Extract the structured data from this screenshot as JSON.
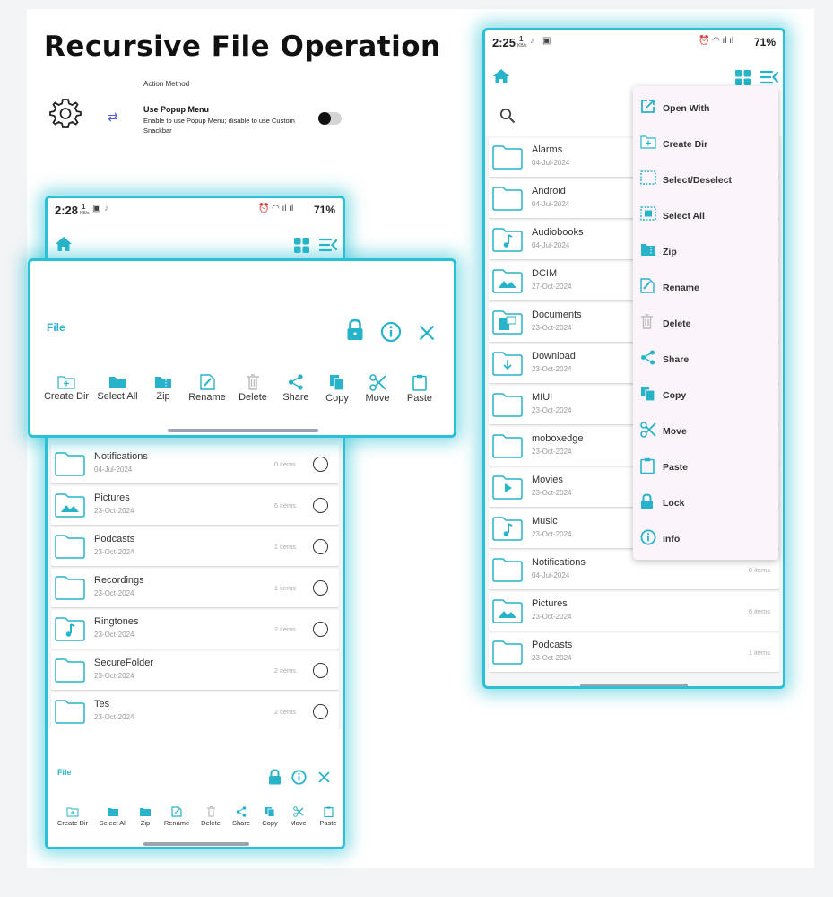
{
  "page": {
    "title": "Recursive File Operation"
  },
  "settings": {
    "section_label": "Action Method",
    "option_title": "Use Popup Menu",
    "option_desc": "Enable to use Popup Menu; disable to use Custom Snackbar",
    "toggle_on": false
  },
  "left_phone": {
    "status": {
      "time": "2:28",
      "speed_value": "1",
      "speed_unit": "KB/s",
      "battery": "71%"
    },
    "rows": [
      {
        "name": "Notifications",
        "date": "04-Jul-2024",
        "count": "0 items",
        "icon": "folder"
      },
      {
        "name": "Pictures",
        "date": "23-Oct-2024",
        "count": "6 items",
        "icon": "image-folder"
      },
      {
        "name": "Podcasts",
        "date": "23-Oct-2024",
        "count": "1 items",
        "icon": "folder"
      },
      {
        "name": "Recordings",
        "date": "23-Oct-2024",
        "count": "1 items",
        "icon": "folder"
      },
      {
        "name": "Ringtones",
        "date": "23-Oct-2024",
        "count": "2 items",
        "icon": "music-folder"
      },
      {
        "name": "SecureFolder",
        "date": "23-Oct-2024",
        "count": "2 items",
        "icon": "folder"
      },
      {
        "name": "Tes",
        "date": "23-Oct-2024",
        "count": "2 items",
        "icon": "folder"
      }
    ],
    "bottom_panel": {
      "title": "File",
      "actions": [
        "Create Dir",
        "Select All",
        "Zip",
        "Rename",
        "Delete",
        "Share",
        "Copy",
        "Move",
        "Paste"
      ]
    }
  },
  "popup": {
    "title": "File",
    "actions": [
      "Create Dir",
      "Select All",
      "Zip",
      "Rename",
      "Delete",
      "Share",
      "Copy",
      "Move",
      "Paste"
    ]
  },
  "right_phone": {
    "status": {
      "time": "2:25",
      "speed_value": "1",
      "speed_unit": "KB/s",
      "battery": "71%"
    },
    "rows": [
      {
        "name": "Alarms",
        "date": "04-Jul-2024",
        "count": "",
        "icon": "folder"
      },
      {
        "name": "Android",
        "date": "04-Jul-2024",
        "count": "",
        "icon": "folder"
      },
      {
        "name": "Audiobooks",
        "date": "04-Jul-2024",
        "count": "",
        "icon": "music-folder"
      },
      {
        "name": "DCIM",
        "date": "27-Oct-2024",
        "count": "",
        "icon": "image-folder"
      },
      {
        "name": "Documents",
        "date": "23-Oct-2024",
        "count": "",
        "icon": "doc-folder"
      },
      {
        "name": "Download",
        "date": "23-Oct-2024",
        "count": "",
        "icon": "download-folder"
      },
      {
        "name": "MIUI",
        "date": "23-Oct-2024",
        "count": "",
        "icon": "folder"
      },
      {
        "name": "moboxedge",
        "date": "23-Oct-2024",
        "count": "",
        "icon": "folder"
      },
      {
        "name": "Movies",
        "date": "23-Oct-2024",
        "count": "",
        "icon": "play-folder"
      },
      {
        "name": "Music",
        "date": "23-Oct-2024",
        "count": "",
        "icon": "music-folder"
      },
      {
        "name": "Notifications",
        "date": "04-Jul-2024",
        "count": "0 items",
        "icon": "folder"
      },
      {
        "name": "Pictures",
        "date": "23-Oct-2024",
        "count": "6 items",
        "icon": "image-folder"
      },
      {
        "name": "Podcasts",
        "date": "23-Oct-2024",
        "count": "1 items",
        "icon": "folder"
      }
    ],
    "context_menu": [
      {
        "label": "Open With",
        "icon": "open-with-icon"
      },
      {
        "label": "Create Dir",
        "icon": "create-dir-icon"
      },
      {
        "label": "Select/Deselect",
        "icon": "select-deselect-icon"
      },
      {
        "label": "Select All",
        "icon": "select-all-icon"
      },
      {
        "label": "Zip",
        "icon": "zip-icon"
      },
      {
        "label": "Rename",
        "icon": "rename-icon"
      },
      {
        "label": "Delete",
        "icon": "delete-icon"
      },
      {
        "label": "Share",
        "icon": "share-icon"
      },
      {
        "label": "Copy",
        "icon": "copy-icon"
      },
      {
        "label": "Move",
        "icon": "move-icon"
      },
      {
        "label": "Paste",
        "icon": "paste-icon"
      },
      {
        "label": "Lock",
        "icon": "lock-icon"
      },
      {
        "label": "Info",
        "icon": "info-icon"
      }
    ]
  },
  "colors": {
    "accent": "#27b3c9",
    "glow": "#2bc1d4",
    "menu_bg": "#fbf5fb"
  }
}
